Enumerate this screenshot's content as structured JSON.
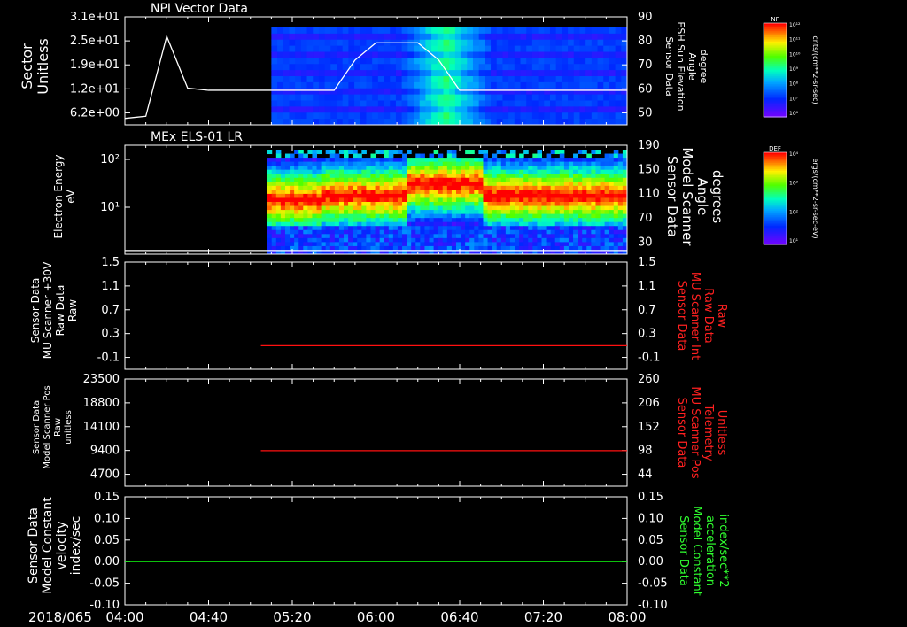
{
  "time_axis": {
    "date_label": "2018/065",
    "ticks": [
      "04:00",
      "04:40",
      "05:20",
      "06:00",
      "06:40",
      "07:20",
      "08:00"
    ],
    "start": "04:00",
    "end": "08:00"
  },
  "chart_data": [
    {
      "type": "heatmap",
      "title": "NPI Vector Data",
      "ylabel": [
        "Sector",
        "Unitless"
      ],
      "y_ticks": [
        "3.1e+01",
        "2.5e+01",
        "1.9e+01",
        "1.2e+01",
        "6.2e+00"
      ],
      "right_ylabel": [
        "Sensor Data",
        "ESH Sun Elevation",
        "Angle",
        "degree"
      ],
      "right_ticks": [
        "90",
        "80",
        "70",
        "60",
        "50"
      ],
      "right_range": [
        40,
        90
      ],
      "data_start": "05:10",
      "overlay_line": {
        "name": "ESH Sun Elevation Angle",
        "x": [
          "04:00",
          "04:10",
          "04:20",
          "04:30",
          "04:40",
          "05:00",
          "05:20",
          "05:40",
          "05:50",
          "06:00",
          "06:10",
          "06:20",
          "06:30",
          "06:40",
          "07:00",
          "07:20",
          "07:40",
          "08:00"
        ],
        "y": [
          43,
          44,
          81,
          57,
          56,
          56,
          56,
          56,
          70,
          78,
          78,
          78,
          70,
          56,
          56,
          56,
          56,
          56
        ]
      },
      "colorbar": {
        "label": "NF",
        "units": "cnts/(cm**2-sr-sec)",
        "ticks": [
          "10¹²",
          "10¹¹",
          "10¹⁰",
          "10⁹",
          "10⁸",
          "10⁷",
          "10⁶"
        ]
      }
    },
    {
      "type": "heatmap",
      "title": "MEx ELS-01 LR",
      "ylabel": [
        "Electron Energy",
        "eV"
      ],
      "y_ticks": [
        "10²",
        "10¹"
      ],
      "right_ylabel": [
        "Sensor Data",
        "Model Scanner",
        "Angle",
        "degrees"
      ],
      "right_ticks": [
        "190",
        "150",
        "110",
        "70",
        "30"
      ],
      "right_range": [
        10,
        190
      ],
      "data_start": "05:08",
      "overlay_line": {
        "name": "Model Scanner Angle",
        "x": [
          "04:00",
          "08:00"
        ],
        "y": [
          16,
          16
        ]
      },
      "colorbar": {
        "label": "DEF",
        "units": "ergs/(cm**2-sr-sec-eV)",
        "ticks": [
          "10⁴",
          "10³",
          "10²",
          "10¹"
        ]
      }
    },
    {
      "type": "line",
      "ylabel": [
        "Sensor Data",
        "MU Scanner +30V",
        "Raw Data",
        "Raw"
      ],
      "y_ticks": [
        "1.5",
        "1.1",
        "0.7",
        "0.3",
        "-0.1"
      ],
      "ylim": [
        -0.5,
        1.5
      ],
      "right_ylabel": [
        "Sensor Data",
        "MU Scanner Int",
        "Raw Data",
        "Raw"
      ],
      "right_ticks": [
        "1.5",
        "1.1",
        "0.7",
        "0.3",
        "-0.1"
      ],
      "right_color": "#ff2020",
      "series": [
        {
          "x": [
            "05:05",
            "08:00"
          ],
          "y": [
            -0.06,
            -0.06
          ],
          "color": "#ff1010"
        }
      ]
    },
    {
      "type": "line",
      "ylabel": [
        "Sensor Data",
        "Model Scanner Pos",
        "Raw",
        "unitless"
      ],
      "y_ticks": [
        "23500",
        "18800",
        "14100",
        "9400",
        "4700"
      ],
      "ylim": [
        0,
        23500
      ],
      "right_ylabel": [
        "Sensor Data",
        "MU Scanner Pos",
        "Telemetry",
        "Unitless"
      ],
      "right_ticks": [
        "260",
        "206",
        "152",
        "98",
        "44"
      ],
      "right_color": "#ff2020",
      "series": [
        {
          "x": [
            "05:05",
            "08:00"
          ],
          "y": [
            7800,
            7800
          ],
          "color": "#ff1010"
        }
      ]
    },
    {
      "type": "line",
      "ylabel": [
        "Sensor Data",
        "Model Constant",
        "velocity",
        "index/sec"
      ],
      "y_ticks": [
        "0.15",
        "0.10",
        "0.05",
        "0.00",
        "-0.05",
        "-0.10"
      ],
      "ylim": [
        -0.1,
        0.15
      ],
      "right_ylabel": [
        "Sensor Data",
        "Model Constant",
        "acceleration",
        "index/sec**2"
      ],
      "right_ticks": [
        "0.15",
        "0.10",
        "0.05",
        "0.00",
        "-0.05",
        "-0.10"
      ],
      "right_color": "#30ff30",
      "series": [
        {
          "x": [
            "04:00",
            "08:00"
          ],
          "y": [
            0.0,
            0.0
          ],
          "color": "#10ff10"
        }
      ]
    }
  ]
}
